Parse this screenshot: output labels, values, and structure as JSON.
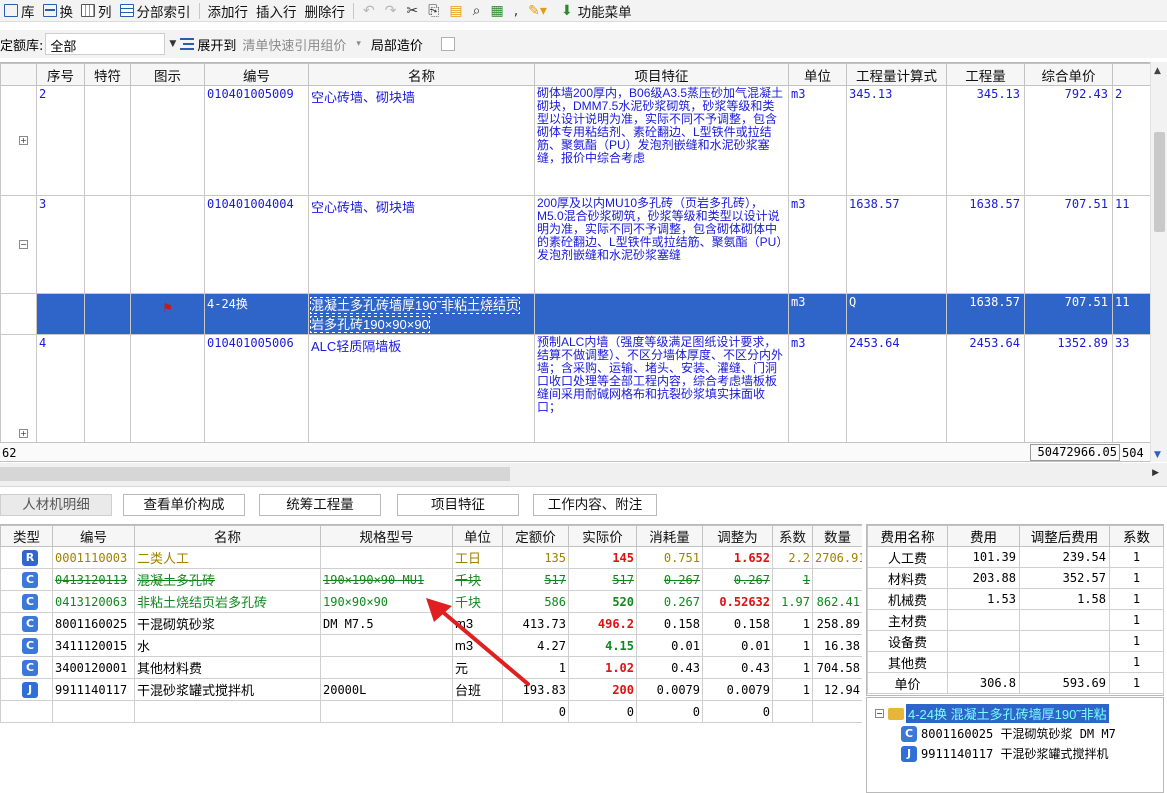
{
  "toolbar1": {
    "items": [
      {
        "label": "库"
      },
      {
        "label": "换"
      },
      {
        "label": "列"
      },
      {
        "label": "分部索引"
      },
      {
        "label": "添加行"
      },
      {
        "label": "插入行"
      },
      {
        "label": "删除行"
      },
      {
        "label": "功能菜单"
      }
    ]
  },
  "toolbar2": {
    "quota_label": "定额库:",
    "quota_value": "全部",
    "expand_label": "展开到",
    "quick_ref_label": "清单快速引用组价",
    "local_cost_label": "局部造价"
  },
  "top_grid": {
    "columns": [
      "序号",
      "特符",
      "图示",
      "编号",
      "名称",
      "项目特征",
      "单位",
      "工程量计算式",
      "工程量",
      "综合单价"
    ],
    "rows": [
      {
        "seq": "2",
        "code": "010401005009",
        "name": "空心砖墙、砌块墙",
        "feature": "砌体墙200厚内，B06级A3.5蒸压砂加气混凝土砌块，DMM7.5水泥砂浆砌筑，砂浆等级和类型以设计说明为准，实际不同不予调整，包含砌体专用粘结剂、素砼翻边、L型铁件或拉结筋、聚氨酯（PU）发泡剂嵌缝和水泥砂浆塞缝，报价中综合考虑",
        "unit": "m3",
        "formula": "345.13",
        "qty": "345.13",
        "price": "792.43",
        "extra": "2",
        "tree": "+"
      },
      {
        "seq": "3",
        "code": "010401004004",
        "name": "空心砖墙、砌块墙",
        "feature": "200厚及以内MU10多孔砖（页岩多孔砖），M5.0混合砂浆砌筑，砂浆等级和类型以设计说明为准，实际不同不予调整，包含砌体砌体中的素砼翻边、L型铁件或拉结筋、聚氨酯（PU）发泡剂嵌缝和水泥砂浆塞缝",
        "unit": "m3",
        "formula": "1638.57",
        "qty": "1638.57",
        "price": "707.51",
        "extra": "11",
        "tree": "−"
      },
      {
        "seq": "",
        "code": "4-24换",
        "name": "混凝土多孔砖墙厚190˜非粘土烧结页岩多孔砖190×90×90",
        "feature": "",
        "unit": "m3",
        "formula": "Q",
        "qty": "1638.57",
        "price": "707.51",
        "extra": "11",
        "tree": "",
        "selected": true
      },
      {
        "seq": "4",
        "code": "010401005006",
        "name": "ALC轻质隔墙板",
        "feature": "预制ALC内墙（强度等级满足图纸设计要求，结算不做调整）、不区分墙体厚度、不区分内外墙；含采购、运输、堵头、安装、灌缝、门洞口收口处理等全部工程内容，综合考虑墙板板缝间采用耐碱网格布和抗裂砂浆填实抹面收口；",
        "unit": "m3",
        "formula": "2453.64",
        "qty": "2453.64",
        "price": "1352.89",
        "extra": "33",
        "tree": "+"
      }
    ],
    "total_count": "62",
    "total_sum": "50472966.05",
    "total_sum2": "504"
  },
  "detail_tabs": [
    "人材机明细",
    "查看单价构成",
    "统筹工程量",
    "项目特征",
    "工作内容、附注"
  ],
  "bottom_grid": {
    "columns": [
      "类型",
      "编号",
      "名称",
      "规格型号",
      "单位",
      "定额价",
      "实际价",
      "消耗量",
      "调整为",
      "系数",
      "数量"
    ],
    "rows": [
      {
        "type": "R",
        "code": "0001110003",
        "name": "二类人工",
        "spec": "",
        "unit": "工日",
        "base": "135",
        "actual": "145",
        "consume": "0.751",
        "adjust": "1.652",
        "coef": "2.2",
        "qty": "2706.91",
        "style": "olive"
      },
      {
        "type": "C",
        "code": "0413120113",
        "name": "混凝土多孔砖",
        "spec": "190×190×90 MU1",
        "unit": "千块",
        "base": "517",
        "actual": "517",
        "consume": "0.267",
        "adjust": "0.267",
        "coef": "1",
        "qty": "",
        "style": "strike"
      },
      {
        "type": "C",
        "code": "0413120063",
        "name": "非粘土烧结页岩多孔砖",
        "spec": "190×90×90",
        "unit": "千块",
        "base": "586",
        "actual": "520",
        "consume": "0.267",
        "adjust": "0.52632",
        "coef": "1.97",
        "qty": "862.41",
        "style": "green"
      },
      {
        "type": "C",
        "code": "8001160025",
        "name": "干混砌筑砂浆",
        "spec": "DM M7.5",
        "unit": "m3",
        "base": "413.73",
        "actual": "496.2",
        "consume": "0.158",
        "adjust": "0.158",
        "coef": "1",
        "qty": "258.89",
        "style": "plain"
      },
      {
        "type": "C",
        "code": "3411120015",
        "name": "水",
        "spec": "",
        "unit": "m3",
        "base": "4.27",
        "actual": "4.15",
        "consume": "0.01",
        "adjust": "0.01",
        "coef": "1",
        "qty": "16.38",
        "style": "plain"
      },
      {
        "type": "C",
        "code": "3400120001",
        "name": "其他材料费",
        "spec": "",
        "unit": "元",
        "base": "1",
        "actual": "1.02",
        "consume": "0.43",
        "adjust": "0.43",
        "coef": "1",
        "qty": "704.58",
        "style": "plain"
      },
      {
        "type": "J",
        "code": "9911140117",
        "name": "干混砂浆罐式搅拌机",
        "spec": "20000L",
        "unit": "台班",
        "base": "193.83",
        "actual": "200",
        "consume": "0.0079",
        "adjust": "0.0079",
        "coef": "1",
        "qty": "12.94",
        "style": "plain"
      },
      {
        "type": "",
        "code": "",
        "name": "",
        "spec": "",
        "unit": "",
        "base": "0",
        "actual": "0",
        "consume": "0",
        "adjust": "0",
        "coef": "",
        "qty": "",
        "style": "plain"
      }
    ]
  },
  "fee_grid": {
    "columns": [
      "费用名称",
      "费用",
      "调整后费用",
      "系数"
    ],
    "rows": [
      {
        "name": "人工费",
        "fee": "101.39",
        "adjusted": "239.54",
        "coef": "1"
      },
      {
        "name": "材料费",
        "fee": "203.88",
        "adjusted": "352.57",
        "coef": "1"
      },
      {
        "name": "机械费",
        "fee": "1.53",
        "adjusted": "1.58",
        "coef": "1"
      },
      {
        "name": "主材费",
        "fee": "",
        "adjusted": "",
        "coef": "1"
      },
      {
        "name": "设备费",
        "fee": "",
        "adjusted": "",
        "coef": "1"
      },
      {
        "name": "其他费",
        "fee": "",
        "adjusted": "",
        "coef": "1"
      },
      {
        "name": "单价",
        "fee": "306.8",
        "adjusted": "593.69",
        "coef": "1"
      }
    ]
  },
  "tree_panel": {
    "root": "4-24换 混凝土多孔砖墙厚190˜非粘",
    "children": [
      {
        "type": "C",
        "label": "8001160025 干混砌筑砂浆 DM M7"
      },
      {
        "type": "J",
        "label": "9911140117 干混砂浆罐式搅拌机"
      }
    ]
  },
  "colors": {
    "selection": "#2f64c8",
    "blue_text": "#1a1adc",
    "red": "#e01010",
    "green": "#11881f",
    "olive": "#a08100"
  }
}
